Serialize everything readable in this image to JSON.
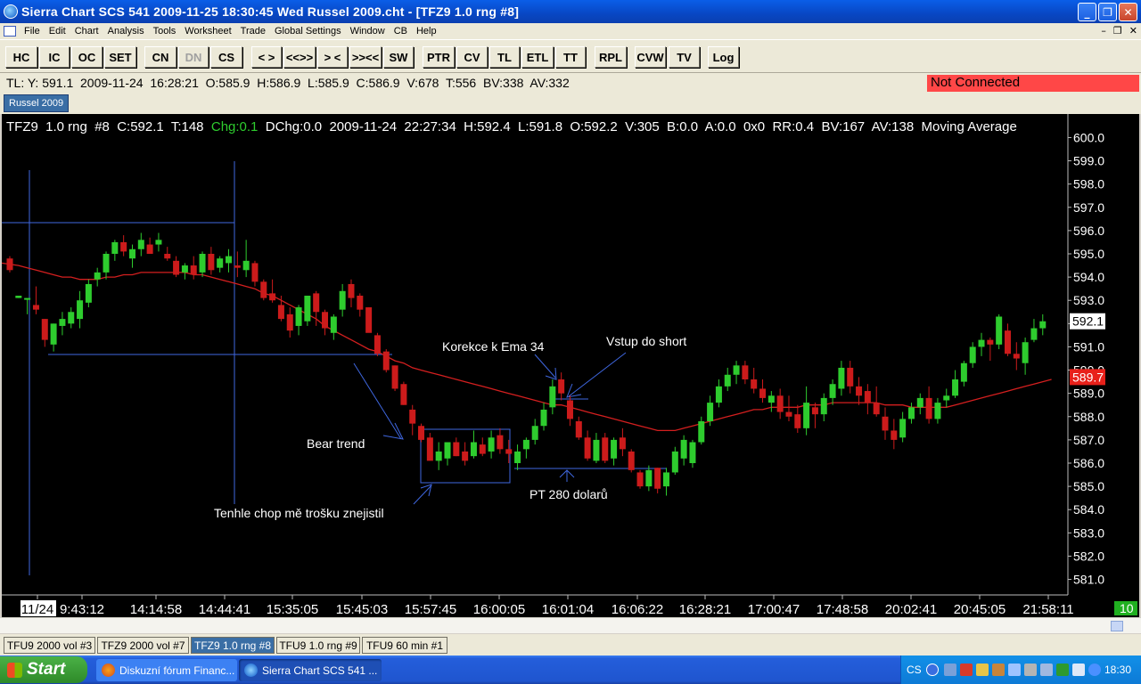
{
  "window": {
    "title": "Sierra Chart SCS 541   2009-11-25  18:30:45  Wed   Russel 2009.cht - [TFZ9  1.0 rng  #8]",
    "min": "_",
    "max": "❐",
    "close": "✕"
  },
  "menu": {
    "items": [
      "File",
      "Edit",
      "Chart",
      "Analysis",
      "Tools",
      "Worksheet",
      "Trade",
      "Global Settings",
      "Window",
      "CB",
      "Help"
    ],
    "mdi": [
      "–",
      "❐",
      "✕"
    ]
  },
  "toolbar": {
    "buttons": [
      "HC",
      "IC",
      "OC",
      "SET",
      "CN",
      "DN",
      "CS",
      "< >",
      "<<>>",
      "> <",
      ">><<",
      "SW",
      "PTR",
      "CV",
      "TL",
      "ETL",
      "TT",
      "RPL",
      "CVW",
      "TV",
      "Log"
    ],
    "disabled": [
      "DN"
    ]
  },
  "infobar": {
    "text": "TL: Y: 591.1  2009-11-24  16:28:21  O:585.9  H:586.9  L:585.9  C:586.9  V:678  T:556  BV:338  AV:332",
    "status": "Not Connected"
  },
  "chartbook_tab": "Russel 2009",
  "chart": {
    "header_pre": "TFZ9  1.0 rng  #8  C:592.1  T:148  ",
    "header_chg": "Chg:0.1",
    "header_post": "  DChg:0.0  2009-11-24  22:27:34  H:592.4  L:591.8  O:592.2  V:305  B:0.0  A:0.0  0x0  RR:0.4  BV:167  AV:138  Moving Average",
    "price_labels": [
      "600.0",
      "599.0",
      "598.0",
      "597.0",
      "596.0",
      "595.0",
      "594.0",
      "593.0",
      "592.0",
      "591.0",
      "590.0",
      "589.0",
      "588.0",
      "587.0",
      "586.0",
      "585.0",
      "584.0",
      "583.0",
      "582.0",
      "581.0"
    ],
    "last_price": "592.1",
    "ma_price": "589.7",
    "time_labels": [
      "11/24",
      "9:43:12",
      "14:14:58",
      "14:44:41",
      "15:35:05",
      "15:45:03",
      "15:57:45",
      "16:00:05",
      "16:01:04",
      "16:06:22",
      "16:28:21",
      "17:00:47",
      "17:48:58",
      "20:02:41",
      "20:45:05",
      "21:58:11"
    ],
    "corner_badge": "10",
    "annotations": {
      "korekce": "Korekce k Ema 34",
      "vstup": "Vstup do short",
      "bear": "Bear trend",
      "pt": "PT 280 dolarů",
      "chop": "Tenhle chop mě trošku znejistil"
    },
    "colors": {
      "up": "#2ecc2e",
      "down": "#cc1b1b",
      "ma": "#d41f1f",
      "lines": "#3f67e0",
      "text": "#ffffff"
    }
  },
  "chart_data": {
    "type": "candlestick",
    "ylim": [
      580.6,
      600.4
    ],
    "candles": [
      {
        "o": 594.8,
        "h": 594.9,
        "l": 594.2,
        "c": 594.3
      },
      {
        "o": 593.1,
        "h": 593.2,
        "l": 593.1,
        "c": 593.2
      },
      {
        "o": 593.1,
        "h": 593.1,
        "l": 592.4,
        "c": 593.1
      },
      {
        "o": 592.8,
        "h": 593.6,
        "l": 592.4,
        "c": 592.6
      },
      {
        "o": 592.2,
        "h": 592.2,
        "l": 591.0,
        "c": 591.3
      },
      {
        "o": 591.1,
        "h": 592.0,
        "l": 590.8,
        "c": 592.0
      },
      {
        "o": 591.9,
        "h": 592.5,
        "l": 591.5,
        "c": 592.2
      },
      {
        "o": 592.0,
        "h": 592.7,
        "l": 591.8,
        "c": 592.5
      },
      {
        "o": 592.2,
        "h": 593.4,
        "l": 591.8,
        "c": 593.0
      },
      {
        "o": 592.9,
        "h": 593.9,
        "l": 592.7,
        "c": 593.7
      },
      {
        "o": 593.9,
        "h": 594.4,
        "l": 593.6,
        "c": 594.2
      },
      {
        "o": 594.2,
        "h": 595.1,
        "l": 593.9,
        "c": 595.0
      },
      {
        "o": 595.0,
        "h": 595.6,
        "l": 594.7,
        "c": 595.5
      },
      {
        "o": 595.5,
        "h": 595.8,
        "l": 594.9,
        "c": 595.1
      },
      {
        "o": 594.8,
        "h": 595.4,
        "l": 594.4,
        "c": 595.2
      },
      {
        "o": 595.2,
        "h": 595.9,
        "l": 594.9,
        "c": 595.6
      },
      {
        "o": 595.4,
        "h": 595.7,
        "l": 595.0,
        "c": 595.0
      },
      {
        "o": 595.4,
        "h": 595.9,
        "l": 595.1,
        "c": 595.6
      },
      {
        "o": 595.0,
        "h": 595.3,
        "l": 594.7,
        "c": 594.8
      },
      {
        "o": 594.7,
        "h": 594.9,
        "l": 594.0,
        "c": 594.1
      },
      {
        "o": 594.2,
        "h": 594.6,
        "l": 593.9,
        "c": 594.5
      },
      {
        "o": 594.5,
        "h": 594.9,
        "l": 593.9,
        "c": 594.1
      },
      {
        "o": 594.2,
        "h": 595.1,
        "l": 594.0,
        "c": 595.0
      },
      {
        "o": 595.0,
        "h": 595.3,
        "l": 594.1,
        "c": 594.3
      },
      {
        "o": 594.4,
        "h": 594.9,
        "l": 594.2,
        "c": 594.8
      },
      {
        "o": 594.6,
        "h": 595.2,
        "l": 594.2,
        "c": 594.9
      },
      {
        "o": 594.5,
        "h": 595.1,
        "l": 594.0,
        "c": 594.4
      },
      {
        "o": 594.3,
        "h": 595.6,
        "l": 594.0,
        "c": 594.7
      },
      {
        "o": 594.6,
        "h": 594.7,
        "l": 593.6,
        "c": 593.8
      },
      {
        "o": 593.8,
        "h": 593.9,
        "l": 593.0,
        "c": 593.1
      },
      {
        "o": 593.3,
        "h": 593.9,
        "l": 592.9,
        "c": 593.0
      },
      {
        "o": 592.8,
        "h": 593.2,
        "l": 592.1,
        "c": 592.2
      },
      {
        "o": 592.4,
        "h": 592.7,
        "l": 591.4,
        "c": 591.7
      },
      {
        "o": 591.9,
        "h": 592.8,
        "l": 591.5,
        "c": 592.7
      },
      {
        "o": 592.1,
        "h": 593.2,
        "l": 591.9,
        "c": 593.2
      },
      {
        "o": 593.3,
        "h": 593.4,
        "l": 591.9,
        "c": 592.5
      },
      {
        "o": 592.5,
        "h": 592.6,
        "l": 591.5,
        "c": 591.8
      },
      {
        "o": 591.6,
        "h": 592.4,
        "l": 591.3,
        "c": 592.3
      },
      {
        "o": 592.6,
        "h": 593.7,
        "l": 592.3,
        "c": 593.4
      },
      {
        "o": 593.7,
        "h": 593.9,
        "l": 592.7,
        "c": 593.1
      },
      {
        "o": 593.2,
        "h": 593.3,
        "l": 592.3,
        "c": 592.6
      },
      {
        "o": 592.7,
        "h": 592.7,
        "l": 591.7,
        "c": 591.6
      },
      {
        "o": 591.5,
        "h": 591.6,
        "l": 590.6,
        "c": 590.7
      },
      {
        "o": 590.8,
        "h": 590.9,
        "l": 589.9,
        "c": 590.0
      },
      {
        "o": 590.2,
        "h": 590.2,
        "l": 589.1,
        "c": 589.2
      },
      {
        "o": 589.4,
        "h": 589.5,
        "l": 588.5,
        "c": 588.5
      },
      {
        "o": 588.3,
        "h": 588.5,
        "l": 587.2,
        "c": 587.7
      },
      {
        "o": 587.6,
        "h": 587.7,
        "l": 586.9,
        "c": 587.0
      },
      {
        "o": 587.1,
        "h": 587.3,
        "l": 586.5,
        "c": 586.1
      },
      {
        "o": 586.1,
        "h": 586.9,
        "l": 585.7,
        "c": 586.5
      },
      {
        "o": 586.2,
        "h": 586.9,
        "l": 585.9,
        "c": 586.9
      },
      {
        "o": 586.9,
        "h": 587.1,
        "l": 586.3,
        "c": 586.3
      },
      {
        "o": 586.5,
        "h": 586.9,
        "l": 585.9,
        "c": 586.1
      },
      {
        "o": 586.3,
        "h": 587.4,
        "l": 586.2,
        "c": 586.9
      },
      {
        "o": 586.8,
        "h": 587.1,
        "l": 586.3,
        "c": 586.4
      },
      {
        "o": 586.5,
        "h": 587.4,
        "l": 586.2,
        "c": 587.1
      },
      {
        "o": 587.2,
        "h": 587.5,
        "l": 586.4,
        "c": 586.6
      },
      {
        "o": 586.6,
        "h": 587.0,
        "l": 586.0,
        "c": 586.4
      },
      {
        "o": 586.0,
        "h": 586.8,
        "l": 585.7,
        "c": 586.5
      },
      {
        "o": 586.6,
        "h": 587.1,
        "l": 586.2,
        "c": 587.0
      },
      {
        "o": 587.0,
        "h": 587.9,
        "l": 586.8,
        "c": 587.6
      },
      {
        "o": 587.6,
        "h": 588.6,
        "l": 587.4,
        "c": 588.3
      },
      {
        "o": 588.4,
        "h": 589.6,
        "l": 588.1,
        "c": 589.3
      },
      {
        "o": 589.6,
        "h": 589.9,
        "l": 588.7,
        "c": 589.0
      },
      {
        "o": 588.7,
        "h": 588.9,
        "l": 587.6,
        "c": 587.9
      },
      {
        "o": 587.8,
        "h": 588.0,
        "l": 587.0,
        "c": 587.1
      },
      {
        "o": 587.1,
        "h": 587.4,
        "l": 586.1,
        "c": 586.2
      },
      {
        "o": 586.1,
        "h": 587.3,
        "l": 586.0,
        "c": 587.0
      },
      {
        "o": 587.1,
        "h": 587.3,
        "l": 586.0,
        "c": 586.1
      },
      {
        "o": 586.2,
        "h": 587.1,
        "l": 585.9,
        "c": 587.0
      },
      {
        "o": 587.1,
        "h": 587.5,
        "l": 586.3,
        "c": 586.6
      },
      {
        "o": 586.5,
        "h": 586.6,
        "l": 585.6,
        "c": 585.7
      },
      {
        "o": 585.6,
        "h": 585.7,
        "l": 584.9,
        "c": 585.0
      },
      {
        "o": 585.0,
        "h": 585.9,
        "l": 584.8,
        "c": 585.7
      },
      {
        "o": 585.8,
        "h": 585.8,
        "l": 584.7,
        "c": 584.9
      },
      {
        "o": 585.0,
        "h": 585.8,
        "l": 584.6,
        "c": 585.6
      },
      {
        "o": 585.6,
        "h": 586.7,
        "l": 585.5,
        "c": 586.5
      },
      {
        "o": 586.2,
        "h": 587.2,
        "l": 585.9,
        "c": 587.0
      },
      {
        "o": 586.0,
        "h": 587.0,
        "l": 585.8,
        "c": 586.9
      },
      {
        "o": 586.9,
        "h": 588.0,
        "l": 586.8,
        "c": 587.8
      },
      {
        "o": 587.8,
        "h": 588.9,
        "l": 587.6,
        "c": 588.6
      },
      {
        "o": 588.6,
        "h": 589.6,
        "l": 588.4,
        "c": 589.3
      },
      {
        "o": 589.3,
        "h": 590.1,
        "l": 589.1,
        "c": 589.8
      },
      {
        "o": 589.8,
        "h": 590.4,
        "l": 589.4,
        "c": 590.2
      },
      {
        "o": 590.2,
        "h": 590.4,
        "l": 589.4,
        "c": 589.6
      },
      {
        "o": 589.6,
        "h": 590.1,
        "l": 589.0,
        "c": 589.2
      },
      {
        "o": 589.2,
        "h": 589.6,
        "l": 588.6,
        "c": 588.8
      },
      {
        "o": 588.6,
        "h": 589.1,
        "l": 588.2,
        "c": 588.9
      },
      {
        "o": 588.9,
        "h": 589.2,
        "l": 587.9,
        "c": 588.2
      },
      {
        "o": 588.2,
        "h": 588.9,
        "l": 587.8,
        "c": 588.0
      },
      {
        "o": 588.1,
        "h": 588.5,
        "l": 587.3,
        "c": 587.5
      },
      {
        "o": 587.5,
        "h": 589.3,
        "l": 587.2,
        "c": 588.6
      },
      {
        "o": 588.4,
        "h": 588.6,
        "l": 587.5,
        "c": 588.1
      },
      {
        "o": 588.1,
        "h": 589.0,
        "l": 587.8,
        "c": 588.8
      },
      {
        "o": 588.8,
        "h": 589.6,
        "l": 588.5,
        "c": 589.4
      },
      {
        "o": 589.2,
        "h": 590.4,
        "l": 588.9,
        "c": 590.1
      },
      {
        "o": 590.1,
        "h": 590.4,
        "l": 589.0,
        "c": 589.3
      },
      {
        "o": 589.3,
        "h": 589.7,
        "l": 588.5,
        "c": 588.9
      },
      {
        "o": 589.1,
        "h": 589.4,
        "l": 588.1,
        "c": 588.6
      },
      {
        "o": 588.6,
        "h": 589.3,
        "l": 588.0,
        "c": 588.1
      },
      {
        "o": 588.0,
        "h": 588.4,
        "l": 587.0,
        "c": 587.4
      },
      {
        "o": 587.4,
        "h": 587.9,
        "l": 586.6,
        "c": 587.0
      },
      {
        "o": 587.1,
        "h": 588.2,
        "l": 586.9,
        "c": 587.9
      },
      {
        "o": 587.9,
        "h": 588.6,
        "l": 587.7,
        "c": 588.4
      },
      {
        "o": 588.4,
        "h": 589.0,
        "l": 588.1,
        "c": 588.8
      },
      {
        "o": 588.8,
        "h": 589.3,
        "l": 587.7,
        "c": 587.9
      },
      {
        "o": 587.9,
        "h": 588.8,
        "l": 587.7,
        "c": 588.6
      },
      {
        "o": 588.7,
        "h": 589.2,
        "l": 588.4,
        "c": 588.9
      },
      {
        "o": 588.9,
        "h": 590.0,
        "l": 588.8,
        "c": 589.6
      },
      {
        "o": 589.5,
        "h": 590.4,
        "l": 589.3,
        "c": 590.3
      },
      {
        "o": 590.3,
        "h": 591.2,
        "l": 590.1,
        "c": 591.0
      },
      {
        "o": 591.0,
        "h": 591.6,
        "l": 590.6,
        "c": 591.3
      },
      {
        "o": 591.3,
        "h": 591.4,
        "l": 590.4,
        "c": 591.1
      },
      {
        "o": 591.1,
        "h": 592.4,
        "l": 590.9,
        "c": 592.3
      },
      {
        "o": 591.7,
        "h": 592.0,
        "l": 590.6,
        "c": 590.7
      },
      {
        "o": 590.7,
        "h": 591.2,
        "l": 590.0,
        "c": 590.5
      },
      {
        "o": 590.3,
        "h": 591.4,
        "l": 589.8,
        "c": 591.2
      },
      {
        "o": 591.3,
        "h": 592.2,
        "l": 591.2,
        "c": 591.8
      },
      {
        "o": 591.8,
        "h": 592.4,
        "l": 591.5,
        "c": 592.1
      }
    ],
    "moving_average": [
      594.6,
      594.5,
      594.4,
      594.3,
      594.2,
      594.1,
      594.0,
      594.0,
      593.9,
      593.9,
      593.9,
      594.0,
      594.0,
      594.1,
      594.1,
      594.2,
      594.2,
      594.2,
      594.2,
      594.2,
      594.2,
      594.1,
      594.1,
      594.0,
      593.9,
      593.8,
      593.7,
      593.6,
      593.5,
      593.3,
      593.2,
      593.0,
      592.8,
      592.6,
      592.4,
      592.2,
      591.9,
      591.7,
      591.5,
      591.3,
      591.1,
      590.9,
      590.8,
      590.6,
      590.4,
      590.3,
      590.1,
      590.0,
      589.9,
      589.8,
      589.7,
      589.6,
      589.5,
      589.4,
      589.3,
      589.2,
      589.1,
      589.0,
      588.9,
      588.8,
      588.7,
      588.6,
      588.5,
      588.5,
      588.4,
      588.3,
      588.2,
      588.1,
      588.0,
      587.9,
      587.8,
      587.7,
      587.6,
      587.5,
      587.4,
      587.4,
      587.4,
      587.5,
      587.6,
      587.7,
      587.8,
      587.9,
      588.0,
      588.1,
      588.2,
      588.3,
      588.3,
      588.4,
      588.4,
      588.4,
      588.4,
      588.5,
      588.5,
      588.5,
      588.6,
      588.6,
      588.6,
      588.6,
      588.6,
      588.6,
      588.5,
      588.5,
      588.5,
      588.4,
      588.4,
      588.4,
      588.4,
      588.4,
      588.5,
      588.6,
      588.7,
      588.8,
      588.9,
      589.0,
      589.1,
      589.2,
      589.3,
      589.4,
      589.5,
      589.6
    ]
  },
  "bottom_tabs": [
    "TFU9  2000 vol  #3",
    "TFZ9  2000 vol  #7",
    "TFZ9  1.0 rng  #8",
    "TFU9  1.0 rng  #9",
    "TFU9  60 min   #1"
  ],
  "active_bottom_tab": 2,
  "taskbar": {
    "start": "Start",
    "tasks": [
      "Diskuzní fórum Financ...",
      "Sierra Chart SCS 541 ..."
    ],
    "lang": "CS",
    "clock": "18:30"
  }
}
